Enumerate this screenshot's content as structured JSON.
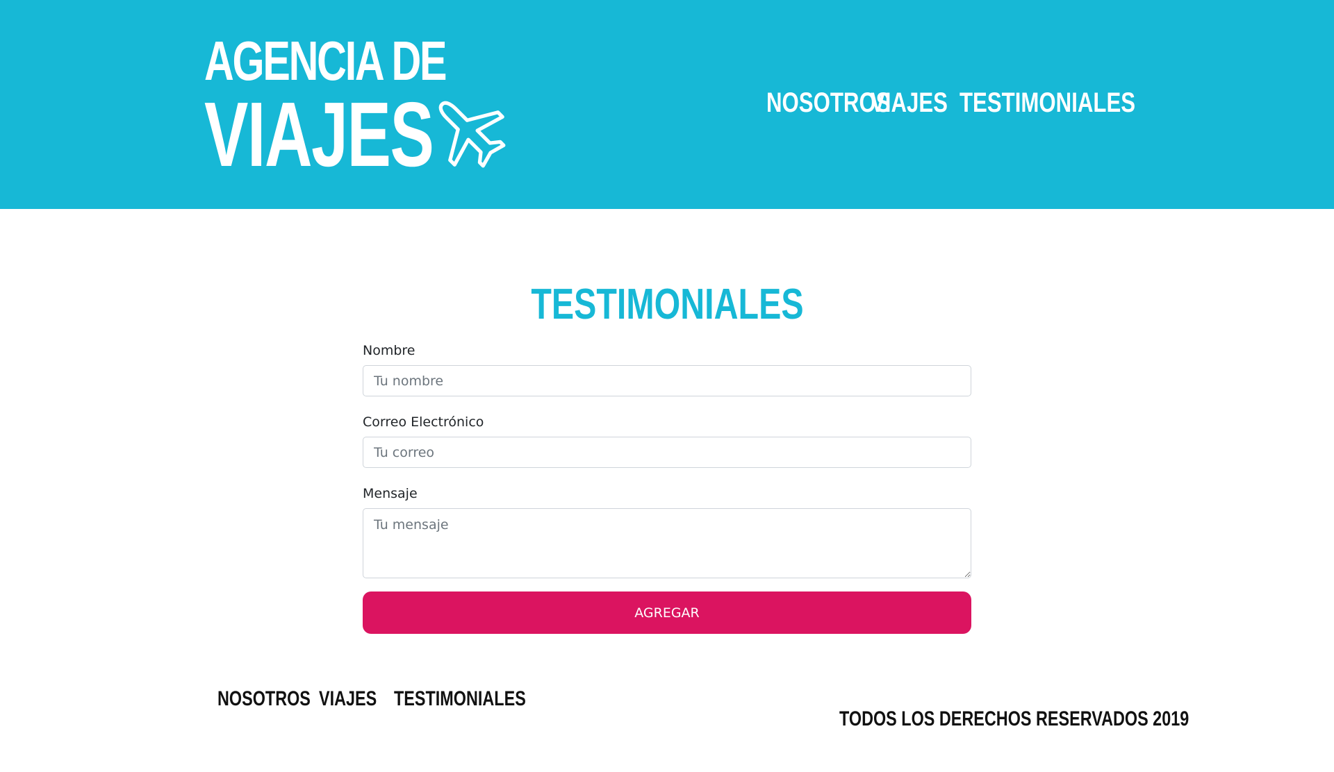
{
  "brand": {
    "line1": "AGENCIA DE",
    "line2": "VIAJES",
    "icon": "airplane-icon"
  },
  "header_nav": [
    "NOSOTROS",
    "VIAJES",
    "TESTIMONIALES"
  ],
  "main": {
    "title": "TESTIMONIALES",
    "form": {
      "name_label": "Nombre",
      "name_placeholder": "Tu nombre",
      "email_label": "Correo Electrónico",
      "email_placeholder": "Tu correo",
      "message_label": "Mensaje",
      "message_placeholder": "Tu mensaje",
      "submit_label": "AGREGAR"
    }
  },
  "footer": {
    "nav": [
      "NOSOTROS",
      "VIAJES",
      "TESTIMONIALES"
    ],
    "copyright": "TODOS LOS DERECHOS RESERVADOS 2019"
  },
  "colors": {
    "header_bg": "#17b8d6",
    "title": "#17b8d6",
    "button_bg": "#db1460",
    "footer_text": "#111111"
  }
}
